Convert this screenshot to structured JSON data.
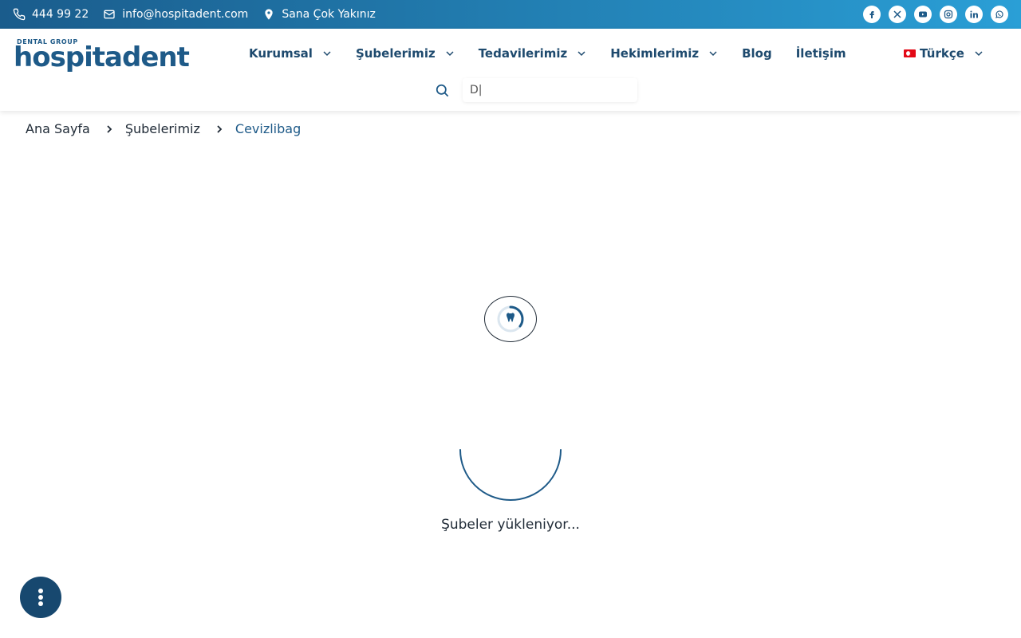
{
  "topbar": {
    "phone": "444 99 22",
    "email": "info@hospitadent.com",
    "location": "Sana Çok Yakınız",
    "socials": [
      "facebook-icon",
      "x-icon",
      "youtube-icon",
      "instagram-icon",
      "linkedin-icon",
      "whatsapp-icon"
    ]
  },
  "brand": {
    "tagline": "DENTAL GROUP",
    "name": "hospitadent",
    "color": "#1e5a88"
  },
  "nav": {
    "items": [
      {
        "label": "Kurumsal",
        "dropdown": true
      },
      {
        "label": "Şubelerimiz",
        "dropdown": true
      },
      {
        "label": "Tedavilerimiz",
        "dropdown": true
      },
      {
        "label": "Hekimlerimiz",
        "dropdown": true
      },
      {
        "label": "Blog",
        "dropdown": false
      },
      {
        "label": "İletişim",
        "dropdown": false
      }
    ]
  },
  "language": {
    "selected": "Türkçe"
  },
  "search": {
    "value": "D|"
  },
  "breadcrumb": {
    "items": [
      "Ana Sayfa",
      "Şubelerimiz",
      "Cevizlibag"
    ]
  },
  "loading": {
    "text": "Şubeler yükleniyor..."
  },
  "colors": {
    "topbar_start": "#1a5c8c",
    "topbar_end": "#2a9fd6",
    "nav_text": "#1e4a6e",
    "fab": "#17486f"
  }
}
